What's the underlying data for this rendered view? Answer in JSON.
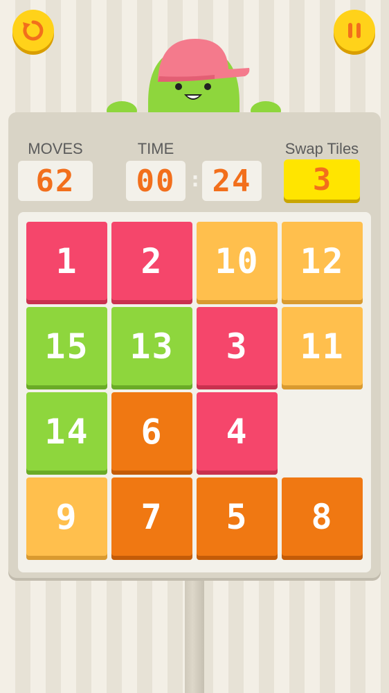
{
  "stats": {
    "moves_label": "MOVES",
    "moves_value": "62",
    "time_label": "TIME",
    "time_minutes": "00",
    "time_seconds": "24",
    "swap_label": "Swap Tiles",
    "swap_value": "3"
  },
  "tiles": [
    {
      "label": "1",
      "color": "pink"
    },
    {
      "label": "2",
      "color": "pink"
    },
    {
      "label": "10",
      "color": "light-orange"
    },
    {
      "label": "12",
      "color": "light-orange"
    },
    {
      "label": "15",
      "color": "green"
    },
    {
      "label": "13",
      "color": "green"
    },
    {
      "label": "3",
      "color": "pink"
    },
    {
      "label": "11",
      "color": "light-orange"
    },
    {
      "label": "14",
      "color": "green"
    },
    {
      "label": "6",
      "color": "dark-orange"
    },
    {
      "label": "4",
      "color": "pink"
    },
    {
      "label": "",
      "color": "empty"
    },
    {
      "label": "9",
      "color": "light-orange"
    },
    {
      "label": "7",
      "color": "dark-orange"
    },
    {
      "label": "5",
      "color": "dark-orange"
    },
    {
      "label": "8",
      "color": "dark-orange"
    }
  ],
  "colors": {
    "pink": "#f5466b",
    "light_orange": "#ffbf4d",
    "green": "#8ed63d",
    "dark_orange": "#f07812",
    "button_yellow": "#ffd21a",
    "digit_orange": "#f26f1c"
  },
  "icons": {
    "restart": "restart-icon",
    "pause": "pause-icon"
  }
}
